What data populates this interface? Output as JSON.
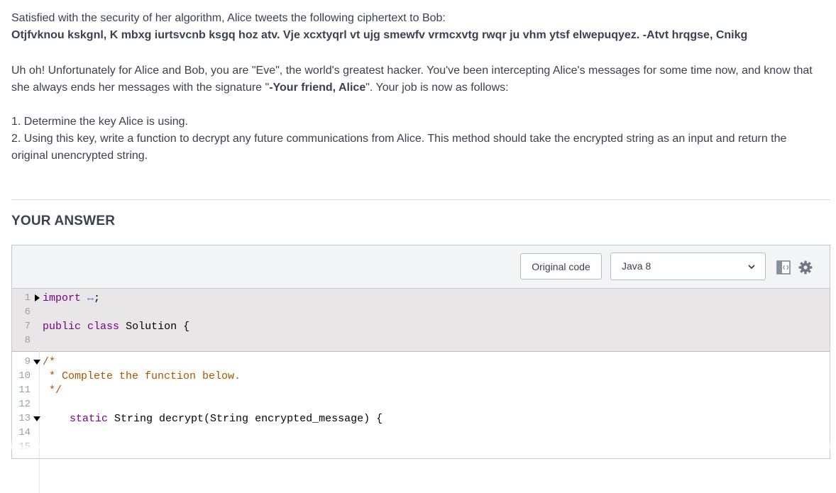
{
  "problem": {
    "intro": "Satisfied with the security of her algorithm, Alice tweets the following ciphertext to Bob:",
    "ciphertext": "Otjfvknou kskgnl, K mbxg iurtsvcnb ksgq hoz atv. Vje xcxtyqrl vt ujg smewfv vrmcxvtg rwqr ju vhm ytsf elwepuqyez. -Atvt hrqgse, Cnikg",
    "para2_before": "Uh oh! Unfortunately for Alice and Bob, you are \"Eve\", the world's greatest hacker. You've been intercepting Alice's messages for some time now, and know that she always ends her messages with the signature \"",
    "signature": "-Your friend, Alice",
    "para2_after": "\". Your job is now as follows:",
    "step1": "1. Determine the key Alice is using.",
    "step2": "2. Using this key, write a function to decrypt any future communications from Alice. This method should take the encrypted string as an input and return the original unencrypted string."
  },
  "answer": {
    "heading": "YOUR ANSWER"
  },
  "toolbar": {
    "original_code_label": "Original code",
    "language": "Java 8"
  },
  "code": {
    "line_numbers": [
      "1",
      "6",
      "7",
      "8",
      "9",
      "10",
      "11",
      "12",
      "13",
      "14",
      "15"
    ],
    "line1_kw": "import",
    "line1_folded": "↔",
    "line1_end": ";",
    "line7_kw1": "public",
    "line7_kw2": "class",
    "line7_rest": "Solution {",
    "line9": "/*",
    "line10": " * Complete the function below.",
    "line11": " */",
    "line13_kw": "static",
    "line13_rest": "String decrypt(String encrypted_message) {"
  },
  "colors": {
    "keyword": "#770088",
    "comment": "#aa5500",
    "locked_bg": "#e8e6e6"
  }
}
